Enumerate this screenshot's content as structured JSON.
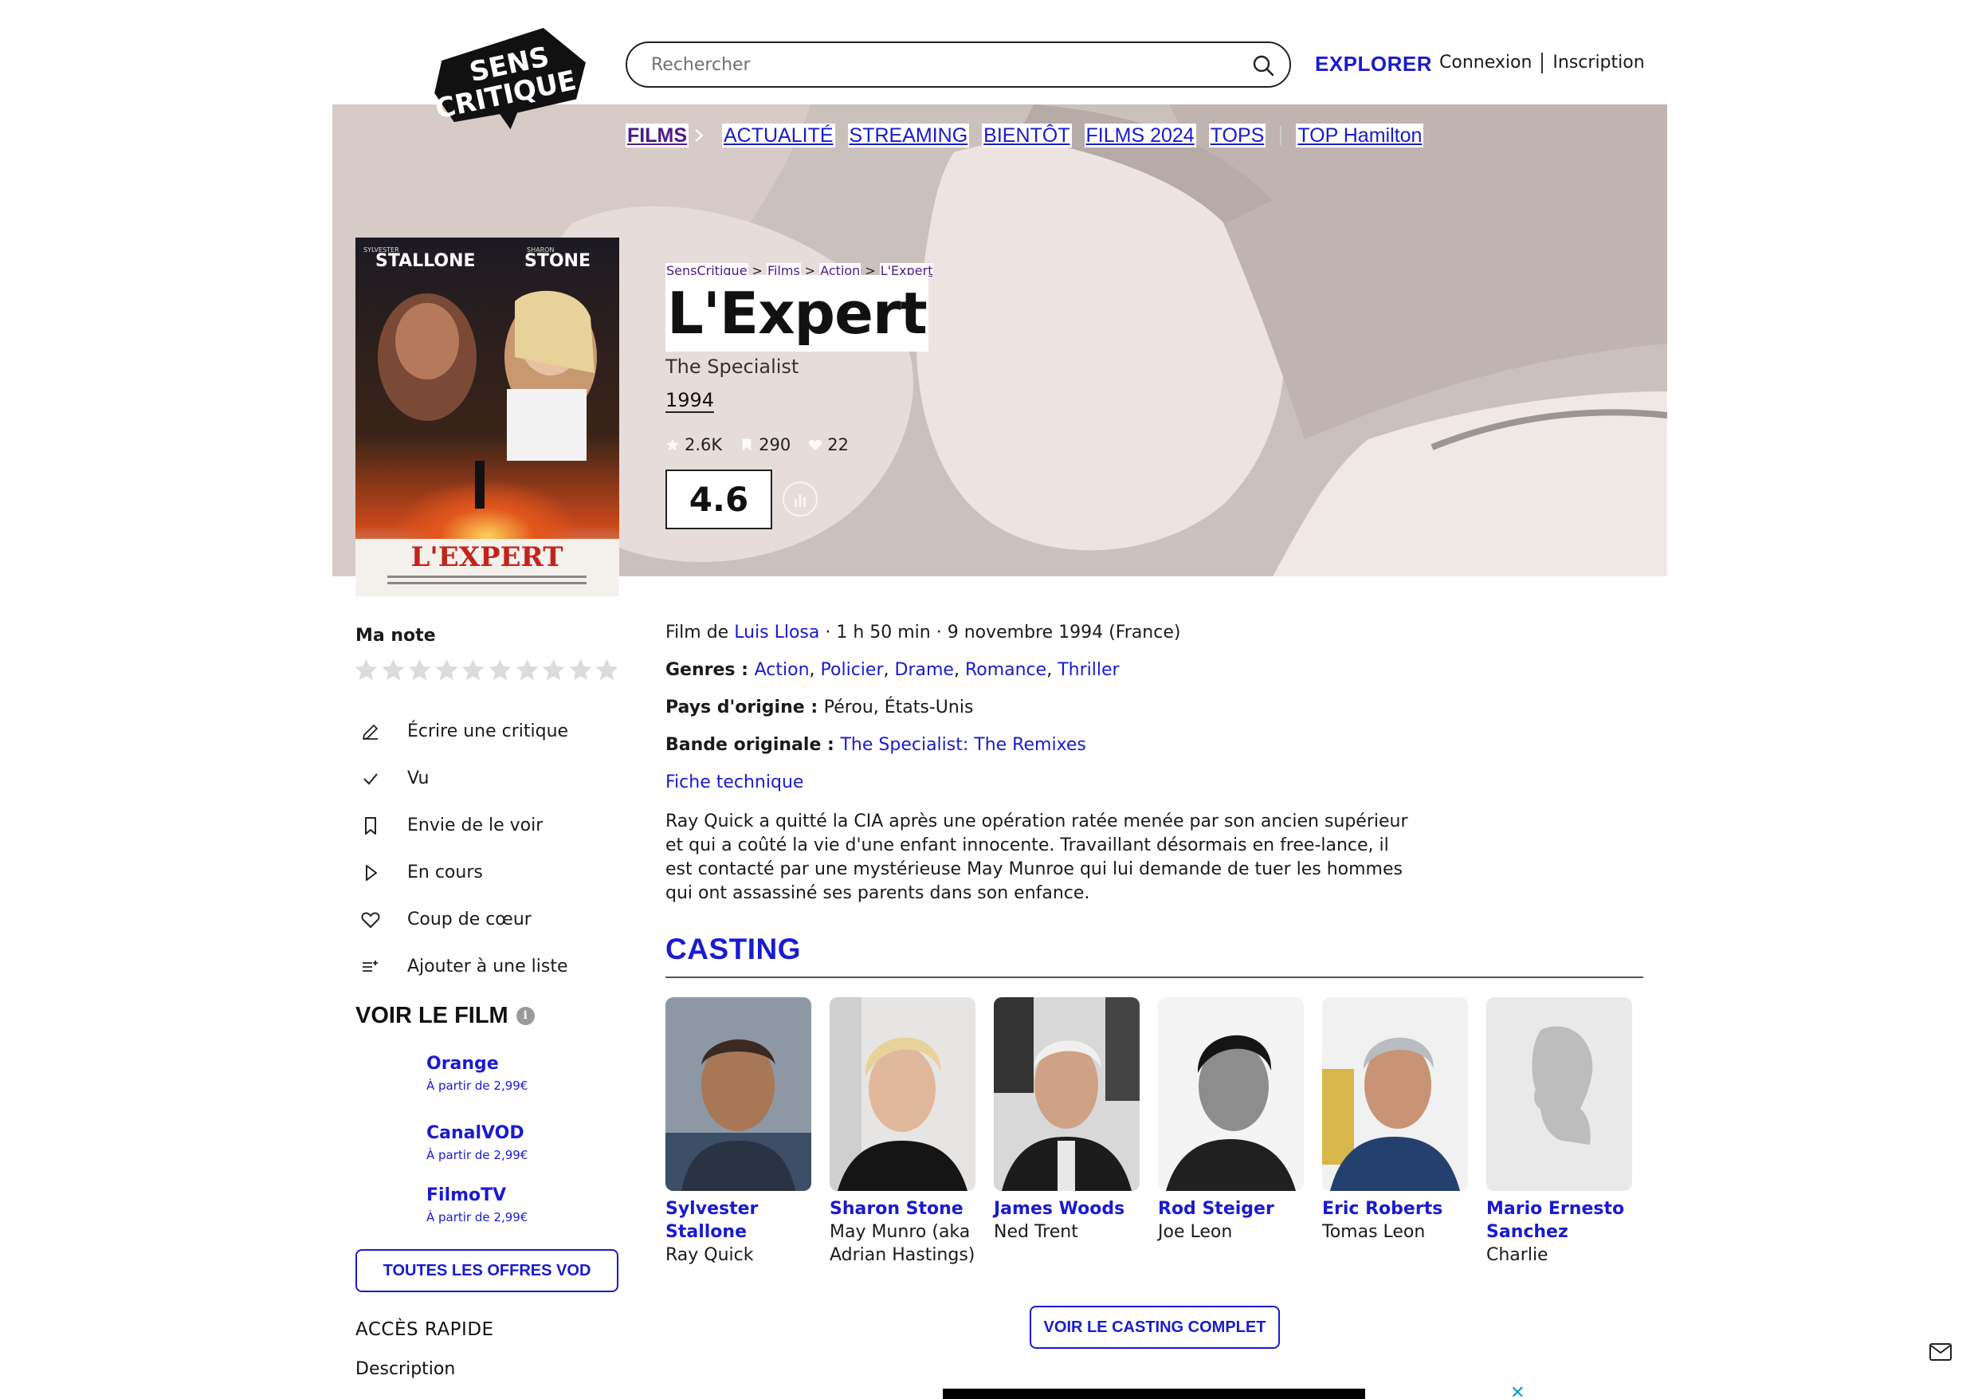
{
  "header": {
    "logo_text": [
      "SENS",
      "CRITIQUE"
    ],
    "search_placeholder": "Rechercher",
    "explorer": "EXPLORER",
    "login": "Connexion",
    "signup": "Inscription"
  },
  "nav": {
    "items": [
      "FILMS",
      "ACTUALITÉ",
      "STREAMING",
      "BIENTÔT",
      "FILMS 2024",
      "TOPS",
      "TOP Hamilton"
    ]
  },
  "breadcrumb": [
    "SensCritique",
    "Films",
    "Action",
    "L'Expert"
  ],
  "movie": {
    "title": "L'Expert",
    "original_title": "The Specialist",
    "year": "1994",
    "stats": {
      "ratings": "2.6K",
      "wishlist": "290",
      "favorites": "22"
    },
    "score": "4.6",
    "poster": {
      "top_left": "STALLONE",
      "top_right": "STONE",
      "top_left_small": "SYLVESTER",
      "top_right_small": "SHARON",
      "title": "L'EXPERT"
    }
  },
  "my_rating": {
    "label": "Ma note",
    "stars": 10,
    "value": 0
  },
  "actions": [
    {
      "label": "Écrire une critique",
      "icon": "pencil-icon"
    },
    {
      "label": "Vu",
      "icon": "check-icon"
    },
    {
      "label": "Envie de le voir",
      "icon": "bookmark-icon"
    },
    {
      "label": "En cours",
      "icon": "play-icon"
    },
    {
      "label": "Coup de cœur",
      "icon": "heart-icon"
    },
    {
      "label": "Ajouter à une liste",
      "icon": "list-add-icon"
    }
  ],
  "voir_le_film": {
    "heading": "VOIR LE FILM",
    "offers": [
      {
        "name": "Orange",
        "price": "À partir de 2,99€"
      },
      {
        "name": "CanalVOD",
        "price": "À partir de 2,99€"
      },
      {
        "name": "FilmoTV",
        "price": "À partir de 2,99€"
      }
    ],
    "all_offers_button": "TOUTES LES OFFRES VOD"
  },
  "acces_rapide": {
    "heading": "ACCÈS RAPIDE",
    "items": [
      "Description"
    ]
  },
  "details": {
    "film_prefix": "Film de ",
    "director": "Luis Llosa",
    "meta": " · 1 h 50 min · 9 novembre 1994 (France)",
    "genres_label": "Genres : ",
    "genres": [
      "Action",
      "Policier",
      "Drame",
      "Romance",
      "Thriller"
    ],
    "country_label": "Pays d'origine : ",
    "country": "Pérou, États-Unis",
    "soundtrack_label": "Bande originale : ",
    "soundtrack": "The Specialist: The Remixes",
    "tech_sheet": "Fiche technique",
    "synopsis": "Ray Quick a quitté la CIA après une opération ratée menée par son ancien supérieur et qui a coûté la vie d'une enfant innocente. Travaillant désormais en free-lance, il est contacté par une mystérieuse May Munroe qui lui demande de tuer les hommes qui ont assassiné ses parents dans son enfance."
  },
  "casting": {
    "heading": "CASTING",
    "members": [
      {
        "name": "Sylvester Stallone",
        "role": "Ray Quick"
      },
      {
        "name": "Sharon Stone",
        "role": "May Munro (aka Adrian Hastings)"
      },
      {
        "name": "James Woods",
        "role": "Ned Trent"
      },
      {
        "name": "Rod Steiger",
        "role": "Joe Leon"
      },
      {
        "name": "Eric Roberts",
        "role": "Tomas Leon"
      },
      {
        "name": "Mario Ernesto Sanchez",
        "role": "Charlie"
      }
    ],
    "full_casting_button": "VOIR LE CASTING COMPLET"
  },
  "ad": {
    "close": "✕"
  },
  "colors": {
    "accent": "#1a1acf",
    "purple": "#4b1a8a",
    "text": "#1a1a1a"
  }
}
